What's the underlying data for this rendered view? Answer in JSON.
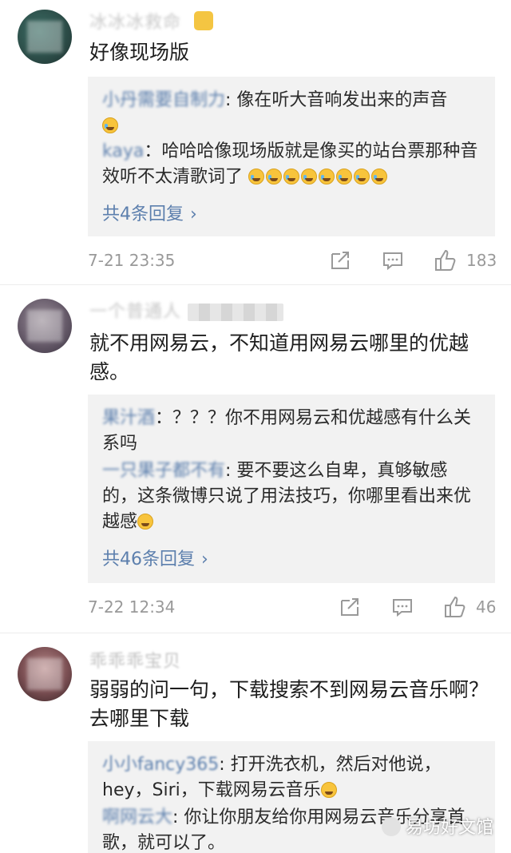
{
  "comments": [
    {
      "username": "冰冰冰救命",
      "text": "好像现场版",
      "replies": [
        {
          "name": "小丹需要自制力",
          "text": ": 像在听大音响发出来的声音",
          "emojis": 1
        },
        {
          "name": "kaya",
          "text": "：哈哈哈像现场版就是像买的站台票那种音效听不太清歌词了",
          "emojis": 8
        }
      ],
      "reply_count": "共4条回复",
      "time": "7-21 23:35",
      "likes": "183"
    },
    {
      "username": "一个普通人",
      "text": "就不用网易云，不知道用网易云哪里的优越感。",
      "replies": [
        {
          "name": "果汁酒",
          "text": "：？？？你不用网易云和优越感有什么关系吗",
          "emojis": 0
        },
        {
          "name": "一只果子都不有",
          "text": ": 要不要这么自卑，真够敏感的，这条微博只说了用法技巧，你哪里看出来优越感",
          "emojis": 1
        }
      ],
      "reply_count": "共46条回复",
      "time": "7-22 12:34",
      "likes": "46"
    },
    {
      "username": "乖乖乖宝贝",
      "text": "弱弱的问一句，下载搜索不到网易云音乐啊？去哪里下载",
      "replies": [
        {
          "name": "小小fancy365",
          "text": ": 打开洗衣机，然后对他说，hey，Siri，下载网易云音乐",
          "emojis": 1
        },
        {
          "name": "啊网云大",
          "text": ": 你让你朋友给你用网易云音乐分享首歌，就可以了。",
          "emojis": 0
        }
      ]
    }
  ],
  "watermark": "易坊好文馆",
  "colors": {
    "link": "#5c7fad",
    "reply_bg": "#f2f2f2",
    "meta": "#999999"
  },
  "icons": [
    "share-icon",
    "comment-icon",
    "like-icon",
    "chevron-right-icon"
  ]
}
